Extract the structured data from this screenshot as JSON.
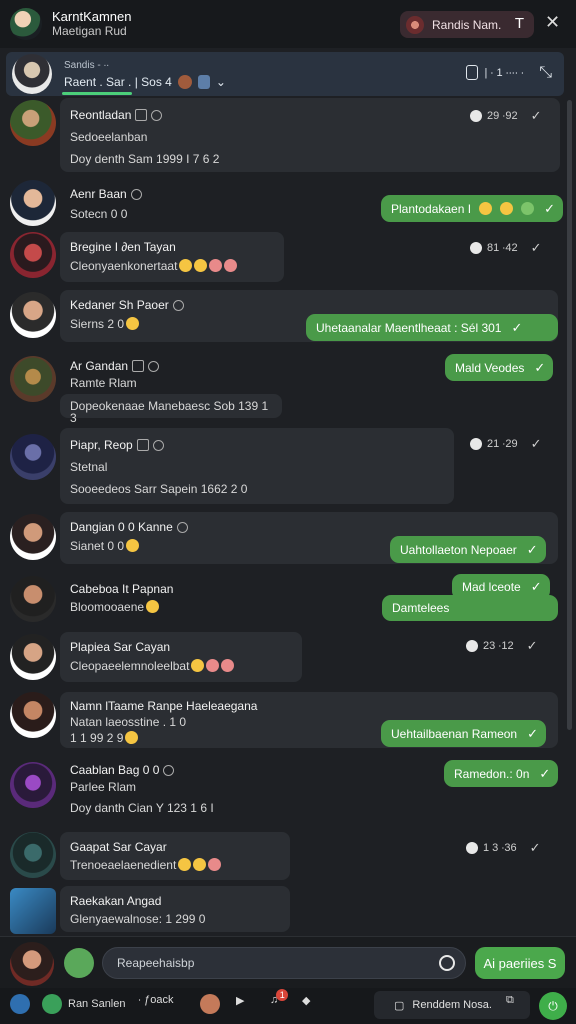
{
  "topbar": {
    "title": "KarntKamnen",
    "subtitle": "Maetigan Rud",
    "pill_label": "Randis Nam.",
    "pill_icon": "T",
    "close": "✕"
  },
  "chat_header": {
    "top_line": "Sandis - ∙∙",
    "main_line": "Raent . Sar . | Sos 4",
    "right_label": "| ∙ 1 ∙∙∙∙ ∙",
    "collapse": "⤡"
  },
  "messages": [
    {
      "name": "Reontladan",
      "line2": "Sedoeelanban",
      "line3": "Doy denth Sam 1999 I 7 6 2",
      "time": "29 ∙92",
      "outgoing": ""
    },
    {
      "name": "Aenr Baan",
      "line2": "Sotecn 0 0",
      "line3": "",
      "time": "",
      "outgoing": "Plantodakaen I"
    },
    {
      "name": "Bregine I ∂en Tayan",
      "line2": "Cleonyaenkonertaat",
      "line3": "",
      "time": "81 ∙42",
      "outgoing": ""
    },
    {
      "name": "Kedaner Sh Paoer",
      "line2": "Sierns 2 0",
      "line3": "",
      "time": "",
      "outgoing": "Uhetaanalar Maentlheaat : Sél 301"
    },
    {
      "name": "Ar Gandan",
      "line2": "Ramte Rlam",
      "line3": "Dopeokenaae Manebaesc Sob 139 1 3",
      "time": "",
      "outgoing": "Mald Veodes"
    },
    {
      "name": "Piapr, Reop",
      "line2": "Stetnal",
      "line3": "Sooeedeos Sarr Sapein 1662 2 0",
      "time": "21 ∙29",
      "outgoing": ""
    },
    {
      "name": "Dangian 0 0 Kanne",
      "line2": "Sianet 0 0",
      "line3": "",
      "time": "",
      "outgoing": "Uahtollaeton Nepoaer"
    },
    {
      "name": "Cabeboa It Papnan",
      "line2": "Bloomooaene",
      "line3": "",
      "time": "",
      "outgoing": "Mad lceote"
    },
    {
      "name": "",
      "line2": "",
      "line3": "",
      "time": "",
      "outgoing": "Damtelees"
    },
    {
      "name": "Plapiea Sar Cayan",
      "line2": "Cleopaeelemnoleelbat",
      "line3": "",
      "time": "23 ∙12",
      "outgoing": ""
    },
    {
      "name": "Namn lTaame Ranpe  Haeleaegana",
      "line2": "Natan laeosstine .  1 0",
      "line3": "1 1 99 2 9",
      "time": "",
      "outgoing": "Uehtailbaenan Rameon"
    },
    {
      "name": "Caablan Bag 0 0",
      "line2": "Parlee Rlam",
      "line3": "Doy danth Cian Y 123 1 6 I",
      "time": "",
      "outgoing": "Ramedon.: 0n"
    },
    {
      "name": "Gaapat Sar Cayar",
      "line2": "Trenoeaelaenedient",
      "line3": "",
      "time": "1 3 ∙36",
      "outgoing": ""
    },
    {
      "name": "Raekakan Angad",
      "line2": "Glenyaewalnose: 1 299 0",
      "line3": "",
      "time": "",
      "outgoing": ""
    }
  ],
  "composer": {
    "placeholder": "Reapeehaisbp",
    "send_label": "Ai paeriies S"
  },
  "bottombar": {
    "item1": "Ran Sanlen",
    "item2": "∙ ƒoack",
    "badge": "1",
    "text_btn": "Renddem Nosa.",
    "green_icon": "⏻"
  },
  "colors": {
    "outgoing_bubble": "#4a9a49",
    "incoming_bubble": "#2b2e33",
    "background": "#1e2024"
  }
}
